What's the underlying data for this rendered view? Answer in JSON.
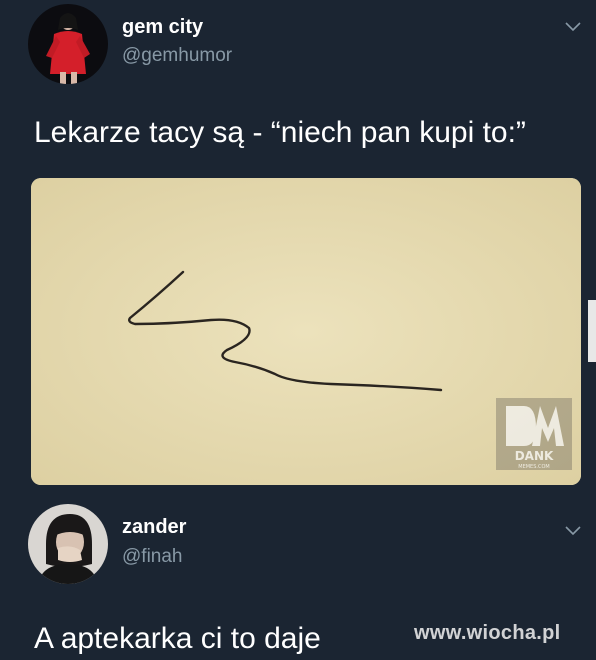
{
  "tweets": [
    {
      "display_name": "gem city",
      "handle": "@gemhumor",
      "avatar_icon": "person-in-red-avatar",
      "text": "Lekarze tacy są - “niech pan kupi to:”",
      "has_media": true,
      "media": {
        "description_icon": "doctor-prescription-scribble",
        "background_color": "#e6dab0",
        "watermark_logo": {
          "letters": "DM",
          "word": "DANK",
          "sub": "MEMES.COM"
        }
      }
    },
    {
      "display_name": "zander",
      "handle": "@finah",
      "avatar_icon": "person-hand-over-mouth-avatar",
      "text": "A aptekarka ci to daje"
    }
  ],
  "site_watermark": "www.wiocha.pl",
  "colors": {
    "background": "#1b2532",
    "handle": "#8899a6",
    "text": "#ffffff",
    "paper": "#e6dab0"
  }
}
